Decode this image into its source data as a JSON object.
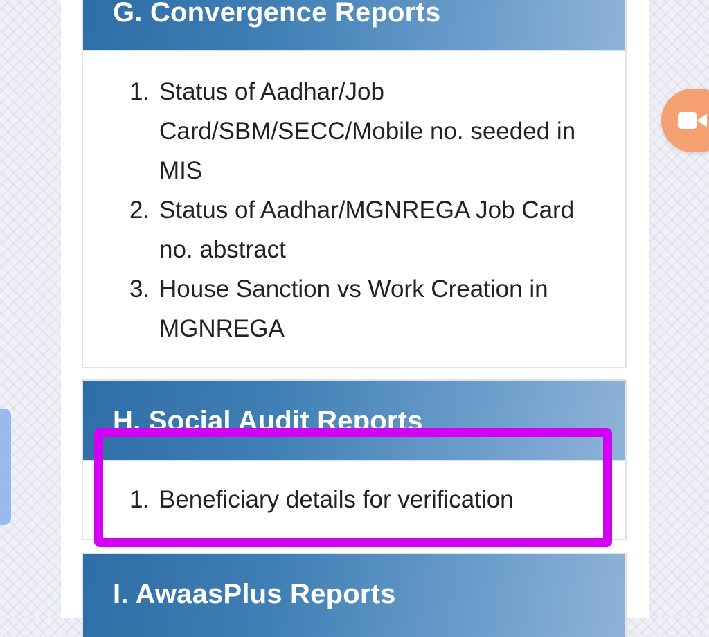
{
  "sections": [
    {
      "title": "G. Convergence Reports",
      "items": [
        {
          "number": "1.",
          "label": "Status of Aadhar/Job Card/SBM/SECC/Mobile no. seeded in MIS"
        },
        {
          "number": "2.",
          "label": "Status of Aadhar/MGNREGA Job Card no. abstract"
        },
        {
          "number": "3.",
          "label": "House Sanction vs Work Creation in MGNREGA"
        }
      ]
    },
    {
      "title": "H. Social Audit Reports",
      "items": [
        {
          "number": "1.",
          "label": "Beneficiary details for verification"
        }
      ]
    },
    {
      "title": "I. AwaasPlus Reports",
      "items": []
    }
  ],
  "highlight": {
    "color": "#d400f4"
  },
  "floating_button": {
    "icon": "video-camera-icon",
    "color": "#f5a070"
  },
  "colors": {
    "header_gradient_start": "#2e6ea6",
    "header_gradient_end": "#8fb3d8",
    "header_text": "#ffffff",
    "body_text": "#222222"
  }
}
